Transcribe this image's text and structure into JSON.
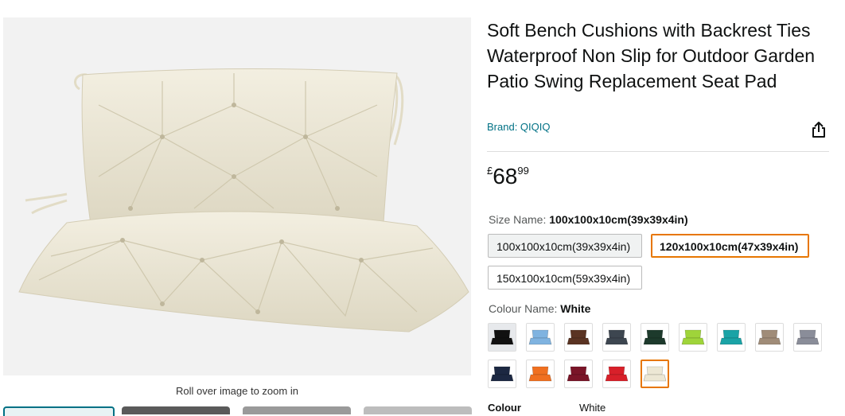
{
  "product": {
    "title": "Soft Bench Cushions with Backrest Ties Waterproof Non Slip for Outdoor Garden Patio Swing Replacement Seat Pad",
    "brand": "Brand: QIQIQ"
  },
  "gallery": {
    "zoom_hint": "Roll over image to zoom in",
    "main_image_icon": "bench-cushion-image"
  },
  "price": {
    "currency": "£",
    "whole": "68",
    "fraction": "99"
  },
  "size": {
    "label": "Size Name: ",
    "selected": "100x100x10cm(39x39x4in)",
    "options": [
      "100x100x10cm(39x39x4in)",
      "120x100x10cm(47x39x4in)",
      "150x100x10cm(59x39x4in)"
    ]
  },
  "colour": {
    "label": "Colour Name: ",
    "selected": "White",
    "swatches": [
      {
        "name": "Black",
        "color": "#111111"
      },
      {
        "name": "Light Blue",
        "color": "#7fb3e0"
      },
      {
        "name": "Brown",
        "color": "#5a3322"
      },
      {
        "name": "Dark Grey",
        "color": "#3d4650"
      },
      {
        "name": "Dark Green",
        "color": "#1d3a2c"
      },
      {
        "name": "Lime",
        "color": "#9fd43a"
      },
      {
        "name": "Teal",
        "color": "#1aa3a6"
      },
      {
        "name": "Taupe",
        "color": "#a08c78"
      },
      {
        "name": "Grey",
        "color": "#8a8d99"
      },
      {
        "name": "Navy",
        "color": "#1c2842"
      },
      {
        "name": "Orange",
        "color": "#f07020"
      },
      {
        "name": "Burgundy",
        "color": "#7a1528"
      },
      {
        "name": "Red",
        "color": "#d8202a"
      },
      {
        "name": "White",
        "color": "#ece7d4"
      }
    ],
    "footer_label": "Colour",
    "footer_value": "White"
  },
  "icons": {
    "share": "share-icon"
  },
  "colors": {
    "link": "#007185",
    "selected_border": "#e77600",
    "cushion": "#ece7d4"
  }
}
